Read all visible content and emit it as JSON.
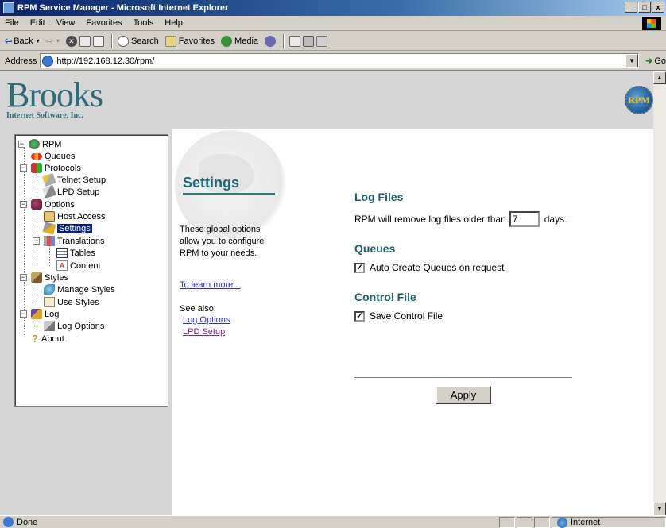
{
  "window": {
    "title": "RPM Service Manager - Microsoft Internet Explorer",
    "buttons": [
      "_",
      "□",
      "x"
    ]
  },
  "menu": [
    "File",
    "Edit",
    "View",
    "Favorites",
    "Tools",
    "Help"
  ],
  "toolbar": {
    "back": "Back",
    "search": "Search",
    "favorites": "Favorites",
    "media": "Media"
  },
  "address": {
    "label": "Address",
    "url": "http://192.168.12.30/rpm/",
    "go": "Go"
  },
  "banner": {
    "logo_main": "Brooks",
    "logo_sub": "Internet Software, Inc.",
    "badge_text": "RPM"
  },
  "tree": {
    "root": "RPM",
    "queues": "Queues",
    "protocols": "Protocols",
    "telnet": "Telnet Setup",
    "lpd": "LPD Setup",
    "options": "Options",
    "host_access": "Host Access",
    "settings": "Settings",
    "translations": "Translations",
    "tables": "Tables",
    "content": "Content",
    "styles": "Styles",
    "manage_styles": "Manage Styles",
    "use_styles": "Use Styles",
    "log": "Log",
    "log_options": "Log Options",
    "about": "About"
  },
  "page": {
    "title": "Settings",
    "desc_1": "These global options",
    "desc_2": "allow you to configure",
    "desc_3": "RPM to your needs.",
    "learn_more": "To learn more...",
    "see_also": "See also:",
    "see_log_options": "Log Options",
    "see_lpd_setup": "LPD Setup"
  },
  "form": {
    "log_files_heading": "Log Files",
    "log_files_text_before": "RPM will remove log files older than",
    "log_days_value": "7",
    "log_files_text_after": "days.",
    "queues_heading": "Queues",
    "auto_create_label": "Auto Create Queues on request",
    "auto_create_checked": true,
    "control_file_heading": "Control File",
    "save_control_label": "Save Control File",
    "save_control_checked": true,
    "apply_label": "Apply"
  },
  "status": {
    "text": "Done",
    "zone": "Internet"
  }
}
